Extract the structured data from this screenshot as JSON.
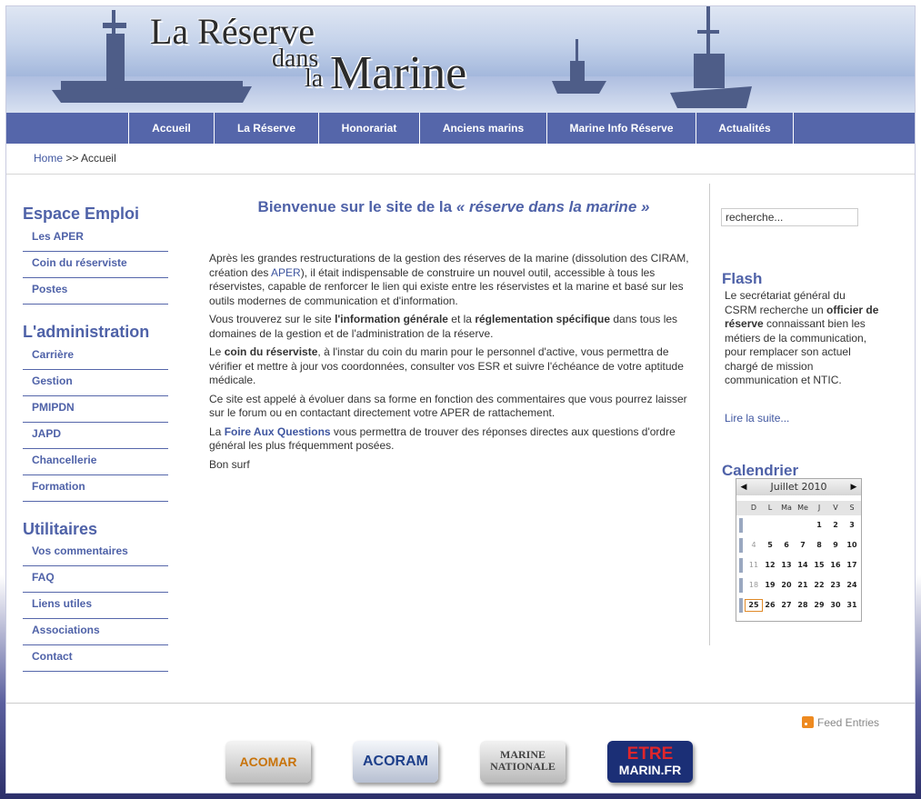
{
  "banner": {
    "title_line1": "La Réserve",
    "title_dans": "dans",
    "title_la": "la",
    "title_marine": "Marine"
  },
  "nav": {
    "items": [
      {
        "label": "Accueil"
      },
      {
        "label": "La Réserve"
      },
      {
        "label": "Honorariat"
      },
      {
        "label": "Anciens marins"
      },
      {
        "label": "Marine Info Réserve"
      },
      {
        "label": "Actualités"
      }
    ]
  },
  "breadcrumb": {
    "home": "Home",
    "separator": ">>",
    "current": "Accueil"
  },
  "sidebar": {
    "sections": [
      {
        "title": "Espace Emploi",
        "items": [
          "Les APER",
          "Coin du réserviste",
          "Postes"
        ]
      },
      {
        "title": "L'administration",
        "items": [
          "Carrière",
          "Gestion",
          "PMIPDN",
          "JAPD",
          "Chancellerie",
          "Formation"
        ]
      },
      {
        "title": "Utilitaires",
        "items": [
          "Vos commentaires",
          "FAQ",
          "Liens utiles",
          "Associations",
          "Contact"
        ]
      }
    ]
  },
  "main": {
    "welcome_prefix": "Bienvenue sur le site de la",
    "welcome_em": "« réserve dans la marine »",
    "p1_a": "Après les grandes restructurations de la gestion des réserves de la marine (dissolution des CIRAM, création des ",
    "p1_link": "APER",
    "p1_b": "), il était indispensable de construire un nouvel outil, accessible à tous les réservistes, capable de renforcer le lien qui existe entre les réservistes et la marine et basé sur les outils modernes de communication et d'information.",
    "p2_a": "Vous trouverez sur le site ",
    "p2_b1": "l'information générale",
    "p2_mid": " et la ",
    "p2_b2": "réglementation spécifique",
    "p2_c": " dans tous les domaines de la gestion et de l'administration de la réserve.",
    "p3_a": "Le ",
    "p3_b": "coin du réserviste",
    "p3_c": ", à l'instar du coin du marin pour le personnel d'active, vous permettra de vérifier et mettre à jour vos coordonnées, consulter vos ESR et suivre l'échéance de votre aptitude médicale.",
    "p4": "Ce site est appelé à évoluer dans sa forme en fonction des commentaires que vous pourrez laisser sur le forum ou en contactant directement votre APER de rattachement.",
    "p5_a": "La ",
    "p5_link": "Foire Aux Questions",
    "p5_b": " vous permettra de trouver des réponses directes aux questions d'ordre général les plus fréquemment posées.",
    "p6": "Bon surf"
  },
  "right": {
    "search_value": "recherche...",
    "flash_title": "Flash",
    "flash_a": "Le secrétariat général du CSRM recherche un ",
    "flash_b": "officier de réserve",
    "flash_c": " connaissant bien les métiers de la communication, pour remplacer son actuel chargé de mission communication et NTIC.",
    "more": "Lire la suite...",
    "calendar_title": "Calendrier"
  },
  "calendar": {
    "month": "Juillet 2010",
    "prev": "◀",
    "next": "▶",
    "dow": [
      "D",
      "L",
      "Ma",
      "Me",
      "J",
      "V",
      "S"
    ],
    "weeks": [
      [
        "",
        "",
        "",
        "",
        "1",
        "2",
        "3"
      ],
      [
        "4",
        "5",
        "6",
        "7",
        "8",
        "9",
        "10"
      ],
      [
        "11",
        "12",
        "13",
        "14",
        "15",
        "16",
        "17"
      ],
      [
        "18",
        "19",
        "20",
        "21",
        "22",
        "23",
        "24"
      ],
      [
        "25",
        "26",
        "27",
        "28",
        "29",
        "30",
        "31"
      ]
    ],
    "today": "25"
  },
  "footer": {
    "feed": "Feed Entries",
    "logos": {
      "acomar": "ACOMAR",
      "acoram": "ACORAM",
      "marine_1": "MARINE",
      "marine_2": "NATIONALE",
      "etre": "ETRE",
      "marin": "MARIN.FR"
    }
  },
  "colors": {
    "accent": "#5566aa",
    "heading": "#4f62a8",
    "link": "#3f56a0",
    "today_outline": "#e08a28"
  }
}
